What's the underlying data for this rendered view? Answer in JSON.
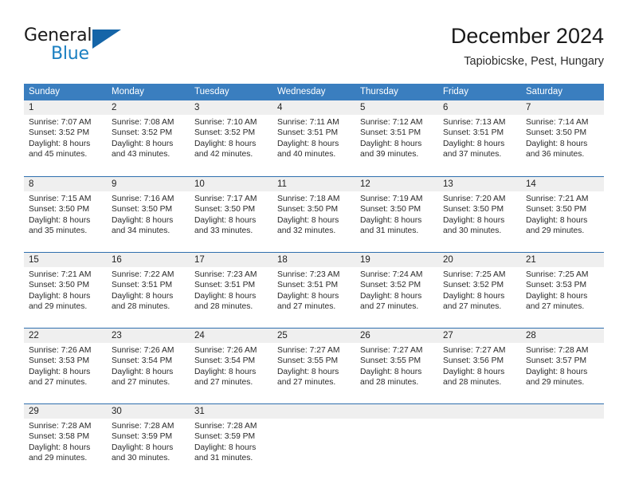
{
  "logo": {
    "word_top": "General",
    "word_bottom": "Blue",
    "triangle_icon": "triangle-icon",
    "brand_color": "#1a7fc1"
  },
  "header": {
    "title": "December 2024",
    "subtitle": "Tapiobicske, Pest, Hungary"
  },
  "colors": {
    "header_blue": "#3a7ebf",
    "row_divider_blue": "#2f6fae",
    "day_band_gray": "#efefef"
  },
  "weekdays": [
    "Sunday",
    "Monday",
    "Tuesday",
    "Wednesday",
    "Thursday",
    "Friday",
    "Saturday"
  ],
  "weeks": [
    [
      {
        "date": "1",
        "lines": [
          "Sunrise: 7:07 AM",
          "Sunset: 3:52 PM",
          "Daylight: 8 hours",
          "and 45 minutes."
        ]
      },
      {
        "date": "2",
        "lines": [
          "Sunrise: 7:08 AM",
          "Sunset: 3:52 PM",
          "Daylight: 8 hours",
          "and 43 minutes."
        ]
      },
      {
        "date": "3",
        "lines": [
          "Sunrise: 7:10 AM",
          "Sunset: 3:52 PM",
          "Daylight: 8 hours",
          "and 42 minutes."
        ]
      },
      {
        "date": "4",
        "lines": [
          "Sunrise: 7:11 AM",
          "Sunset: 3:51 PM",
          "Daylight: 8 hours",
          "and 40 minutes."
        ]
      },
      {
        "date": "5",
        "lines": [
          "Sunrise: 7:12 AM",
          "Sunset: 3:51 PM",
          "Daylight: 8 hours",
          "and 39 minutes."
        ]
      },
      {
        "date": "6",
        "lines": [
          "Sunrise: 7:13 AM",
          "Sunset: 3:51 PM",
          "Daylight: 8 hours",
          "and 37 minutes."
        ]
      },
      {
        "date": "7",
        "lines": [
          "Sunrise: 7:14 AM",
          "Sunset: 3:50 PM",
          "Daylight: 8 hours",
          "and 36 minutes."
        ]
      }
    ],
    [
      {
        "date": "8",
        "lines": [
          "Sunrise: 7:15 AM",
          "Sunset: 3:50 PM",
          "Daylight: 8 hours",
          "and 35 minutes."
        ]
      },
      {
        "date": "9",
        "lines": [
          "Sunrise: 7:16 AM",
          "Sunset: 3:50 PM",
          "Daylight: 8 hours",
          "and 34 minutes."
        ]
      },
      {
        "date": "10",
        "lines": [
          "Sunrise: 7:17 AM",
          "Sunset: 3:50 PM",
          "Daylight: 8 hours",
          "and 33 minutes."
        ]
      },
      {
        "date": "11",
        "lines": [
          "Sunrise: 7:18 AM",
          "Sunset: 3:50 PM",
          "Daylight: 8 hours",
          "and 32 minutes."
        ]
      },
      {
        "date": "12",
        "lines": [
          "Sunrise: 7:19 AM",
          "Sunset: 3:50 PM",
          "Daylight: 8 hours",
          "and 31 minutes."
        ]
      },
      {
        "date": "13",
        "lines": [
          "Sunrise: 7:20 AM",
          "Sunset: 3:50 PM",
          "Daylight: 8 hours",
          "and 30 minutes."
        ]
      },
      {
        "date": "14",
        "lines": [
          "Sunrise: 7:21 AM",
          "Sunset: 3:50 PM",
          "Daylight: 8 hours",
          "and 29 minutes."
        ]
      }
    ],
    [
      {
        "date": "15",
        "lines": [
          "Sunrise: 7:21 AM",
          "Sunset: 3:50 PM",
          "Daylight: 8 hours",
          "and 29 minutes."
        ]
      },
      {
        "date": "16",
        "lines": [
          "Sunrise: 7:22 AM",
          "Sunset: 3:51 PM",
          "Daylight: 8 hours",
          "and 28 minutes."
        ]
      },
      {
        "date": "17",
        "lines": [
          "Sunrise: 7:23 AM",
          "Sunset: 3:51 PM",
          "Daylight: 8 hours",
          "and 28 minutes."
        ]
      },
      {
        "date": "18",
        "lines": [
          "Sunrise: 7:23 AM",
          "Sunset: 3:51 PM",
          "Daylight: 8 hours",
          "and 27 minutes."
        ]
      },
      {
        "date": "19",
        "lines": [
          "Sunrise: 7:24 AM",
          "Sunset: 3:52 PM",
          "Daylight: 8 hours",
          "and 27 minutes."
        ]
      },
      {
        "date": "20",
        "lines": [
          "Sunrise: 7:25 AM",
          "Sunset: 3:52 PM",
          "Daylight: 8 hours",
          "and 27 minutes."
        ]
      },
      {
        "date": "21",
        "lines": [
          "Sunrise: 7:25 AM",
          "Sunset: 3:53 PM",
          "Daylight: 8 hours",
          "and 27 minutes."
        ]
      }
    ],
    [
      {
        "date": "22",
        "lines": [
          "Sunrise: 7:26 AM",
          "Sunset: 3:53 PM",
          "Daylight: 8 hours",
          "and 27 minutes."
        ]
      },
      {
        "date": "23",
        "lines": [
          "Sunrise: 7:26 AM",
          "Sunset: 3:54 PM",
          "Daylight: 8 hours",
          "and 27 minutes."
        ]
      },
      {
        "date": "24",
        "lines": [
          "Sunrise: 7:26 AM",
          "Sunset: 3:54 PM",
          "Daylight: 8 hours",
          "and 27 minutes."
        ]
      },
      {
        "date": "25",
        "lines": [
          "Sunrise: 7:27 AM",
          "Sunset: 3:55 PM",
          "Daylight: 8 hours",
          "and 27 minutes."
        ]
      },
      {
        "date": "26",
        "lines": [
          "Sunrise: 7:27 AM",
          "Sunset: 3:55 PM",
          "Daylight: 8 hours",
          "and 28 minutes."
        ]
      },
      {
        "date": "27",
        "lines": [
          "Sunrise: 7:27 AM",
          "Sunset: 3:56 PM",
          "Daylight: 8 hours",
          "and 28 minutes."
        ]
      },
      {
        "date": "28",
        "lines": [
          "Sunrise: 7:28 AM",
          "Sunset: 3:57 PM",
          "Daylight: 8 hours",
          "and 29 minutes."
        ]
      }
    ],
    [
      {
        "date": "29",
        "lines": [
          "Sunrise: 7:28 AM",
          "Sunset: 3:58 PM",
          "Daylight: 8 hours",
          "and 29 minutes."
        ]
      },
      {
        "date": "30",
        "lines": [
          "Sunrise: 7:28 AM",
          "Sunset: 3:59 PM",
          "Daylight: 8 hours",
          "and 30 minutes."
        ]
      },
      {
        "date": "31",
        "lines": [
          "Sunrise: 7:28 AM",
          "Sunset: 3:59 PM",
          "Daylight: 8 hours",
          "and 31 minutes."
        ]
      },
      {
        "date": "",
        "lines": []
      },
      {
        "date": "",
        "lines": []
      },
      {
        "date": "",
        "lines": []
      },
      {
        "date": "",
        "lines": []
      }
    ]
  ]
}
